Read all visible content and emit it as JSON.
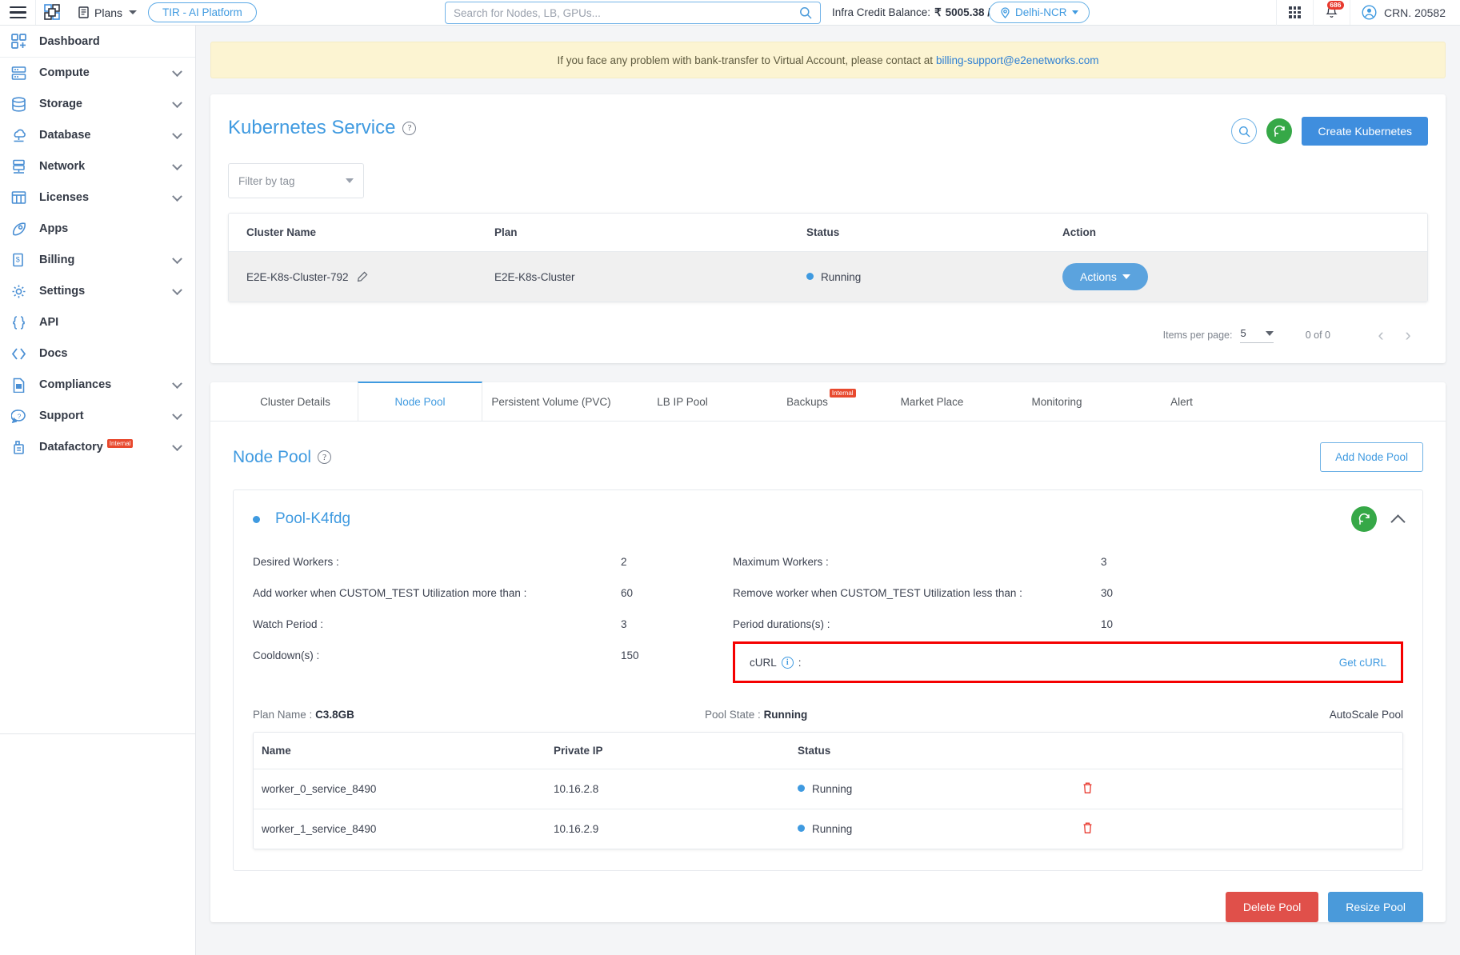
{
  "topbar": {
    "menu_icon": "hamburger-icon",
    "logo_icon": "e2e-networks-logo",
    "plans_label": "Plans",
    "tir_label": "TIR - AI Platform",
    "search_placeholder": "Search for Nodes, LB, GPUs...",
    "balance_label": "Infra Credit Balance:",
    "balance_currency": "₹",
    "balance_value": "5005.38 /-",
    "region": "Delhi-NCR",
    "apps_icon": "grid-apps-icon",
    "notifications_icon": "bell-icon",
    "notification_count": "686",
    "account_icon": "user-avatar-icon",
    "account_label": "CRN. 20582"
  },
  "sidebar": {
    "items": [
      {
        "label": "Dashboard",
        "icon": "dashboard-icon",
        "expandable": false
      },
      {
        "label": "Compute",
        "icon": "server-icon",
        "expandable": true
      },
      {
        "label": "Storage",
        "icon": "database-disk-icon",
        "expandable": true
      },
      {
        "label": "Database",
        "icon": "cloud-database-icon",
        "expandable": true
      },
      {
        "label": "Network",
        "icon": "network-icon",
        "expandable": true
      },
      {
        "label": "Licenses",
        "icon": "license-grid-icon",
        "expandable": true
      },
      {
        "label": "Apps",
        "icon": "rocket-icon",
        "expandable": false
      },
      {
        "label": "Billing",
        "icon": "invoice-icon",
        "expandable": true
      },
      {
        "label": "Settings",
        "icon": "gear-icon",
        "expandable": true
      },
      {
        "label": "API",
        "icon": "braces-icon",
        "expandable": false
      },
      {
        "label": "Docs",
        "icon": "code-angle-icon",
        "expandable": false
      },
      {
        "label": "Compliances",
        "icon": "document-icon",
        "expandable": true
      },
      {
        "label": "Support",
        "icon": "chat-help-icon",
        "expandable": true
      },
      {
        "label": "Datafactory",
        "icon": "datafactory-icon",
        "expandable": true,
        "badge": "Internal"
      }
    ]
  },
  "banner": {
    "text": "If you face any problem with bank-transfer to Virtual Account, please contact at",
    "link": "billing-support@e2enetworks.com"
  },
  "page": {
    "title": "Kubernetes Service",
    "help_icon": "question-mark-icon",
    "search_icon": "search-icon",
    "refresh_icon": "refresh-icon",
    "create_button": "Create Kubernetes",
    "filter_placeholder": "Filter by tag"
  },
  "cluster_table": {
    "columns": [
      "Cluster Name",
      "Plan",
      "Status",
      "Action"
    ],
    "rows": [
      {
        "name": "E2E-K8s-Cluster-792",
        "edit_icon": "pencil-icon",
        "plan": "E2E-K8s-Cluster",
        "status": "Running",
        "status_color": "#3f9ae0",
        "action": "Actions"
      }
    ]
  },
  "paginator": {
    "items_per_page_label": "Items per page:",
    "items_per_page_value": "5",
    "range": "0 of 0",
    "prev_icon": "chevron-left-icon",
    "next_icon": "chevron-right-icon"
  },
  "tabs": [
    {
      "label": "Cluster Details",
      "active": false
    },
    {
      "label": "Node Pool",
      "active": true
    },
    {
      "label": "Persistent Volume (PVC)",
      "active": false
    },
    {
      "label": "LB IP Pool",
      "active": false
    },
    {
      "label": "Backups",
      "active": false,
      "badge": "Internal"
    },
    {
      "label": "Market Place",
      "active": false
    },
    {
      "label": "Monitoring",
      "active": false
    },
    {
      "label": "Alert",
      "active": false
    }
  ],
  "node_pool": {
    "title": "Node Pool",
    "help_icon": "question-mark-icon",
    "add_button": "Add Node Pool",
    "pool": {
      "name": "Pool-K4fdg",
      "status_color": "#3f9ae0",
      "refresh_icon": "refresh-icon",
      "collapse_icon": "chevron-up-icon",
      "details": [
        {
          "label": "Desired Workers :",
          "value": "2"
        },
        {
          "label": "Maximum Workers :",
          "value": "3"
        },
        {
          "label": "Add worker when CUSTOM_TEST Utilization more than :",
          "value": "60"
        },
        {
          "label": "Remove worker when CUSTOM_TEST Utilization less than :",
          "value": "30"
        },
        {
          "label": "Watch Period :",
          "value": "3"
        },
        {
          "label": "Period durations(s) :",
          "value": "10"
        },
        {
          "label": "Cooldown(s) :",
          "value": "150"
        }
      ],
      "curl": {
        "label": "cURL",
        "info_icon": "info-circle-icon",
        "colon": ":",
        "action": "Get cURL",
        "highlight_color": "#f50000"
      },
      "plan_name_label": "Plan Name :",
      "plan_name_value": "C3.8GB",
      "pool_state_label": "Pool State :",
      "pool_state_value": "Running",
      "autoscale_label": "AutoScale Pool",
      "workers_table": {
        "columns": [
          "Name",
          "Private IP",
          "Status",
          ""
        ],
        "rows": [
          {
            "name": "worker_0_service_8490",
            "ip": "10.16.2.8",
            "status": "Running",
            "delete_icon": "trash-icon"
          },
          {
            "name": "worker_1_service_8490",
            "ip": "10.16.2.9",
            "status": "Running",
            "delete_icon": "trash-icon"
          }
        ]
      },
      "delete_button": "Delete Pool",
      "resize_button": "Resize Pool"
    }
  }
}
